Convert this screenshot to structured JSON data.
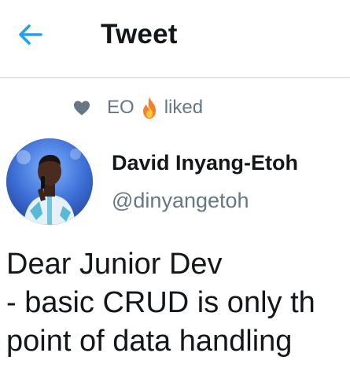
{
  "header": {
    "title": "Tweet"
  },
  "social_context": {
    "name": "EO",
    "action": "liked"
  },
  "author": {
    "name": "David Inyang-Etoh",
    "handle": "@dinyangetoh"
  },
  "tweet": {
    "lines": [
      "Dear Junior Dev",
      "- basic CRUD is only th",
      "point of data handling"
    ]
  },
  "colors": {
    "accent": "#1da1f2",
    "text_primary": "#14171a",
    "text_secondary": "#657786"
  },
  "icons": {
    "back": "arrow-left-icon",
    "like": "heart-icon",
    "emoji": "fire-emoji-icon"
  }
}
